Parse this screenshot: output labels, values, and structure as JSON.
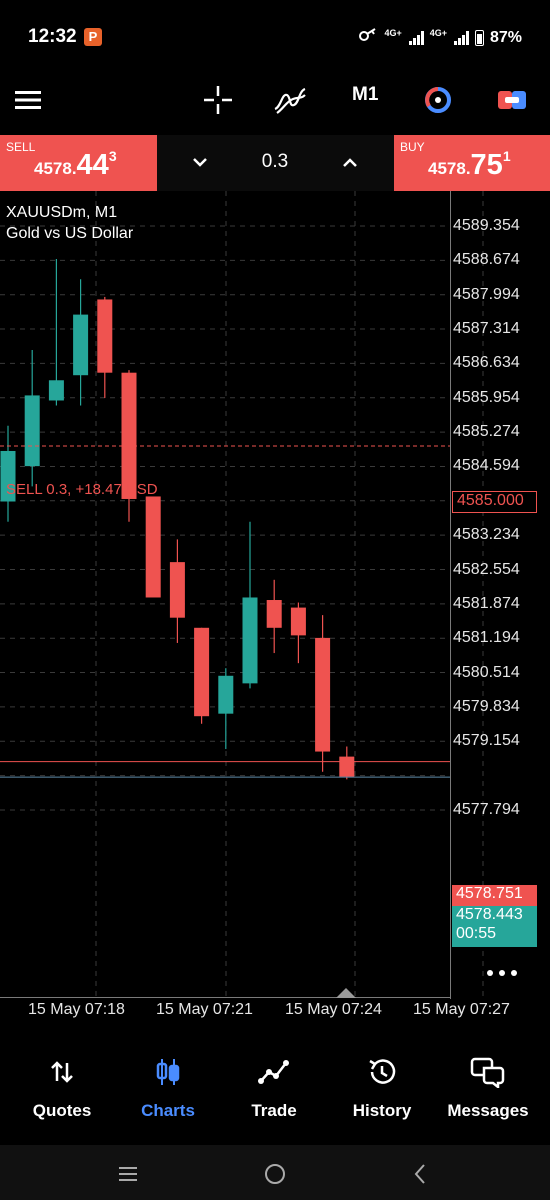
{
  "status": {
    "time": "12:32",
    "app_badge": "P",
    "net1": "4G+",
    "net2": "4G+",
    "battery": "87%"
  },
  "toolbar": {
    "timeframe": "M1"
  },
  "trade": {
    "sell_label": "SELL",
    "sell_small": "4578.",
    "sell_big": "44",
    "sell_sup": "3",
    "buy_label": "BUY",
    "buy_small": "4578.",
    "buy_big": "75",
    "buy_sup": "1",
    "lot": "0.3"
  },
  "chart": {
    "symbol": "XAUUSDm, M1",
    "description": "Gold vs US Dollar",
    "position_label": "SELL 0.3, +18.47 USD",
    "y_labels": [
      "4589.354",
      "4588.674",
      "4587.994",
      "4587.314",
      "4586.634",
      "4585.954",
      "4585.274",
      "4584.594",
      "4583.914",
      "4583.234",
      "4582.554",
      "4581.874",
      "4581.194",
      "4580.514",
      "4579.834",
      "4579.154",
      "4577.794"
    ],
    "x_labels": [
      "15 May 07:18",
      "15 May 07:21",
      "15 May 07:24",
      "15 May 07:27"
    ],
    "order_price_tag": "4585.000",
    "ask_tag": "4578.751",
    "bid_tag": "4578.443",
    "countdown": "00:55",
    "colors": {
      "bull": "#26a69a",
      "bear": "#ef5350",
      "grid": "#3a3a3a",
      "accent": "#4a8cff"
    }
  },
  "chart_data": {
    "type": "candlestick",
    "title": "XAUUSDm, M1",
    "subtitle": "Gold vs US Dollar",
    "ylim": [
      4577.5,
      4590.0
    ],
    "candles": [
      {
        "o": 4583.9,
        "h": 4585.4,
        "l": 4583.5,
        "c": 4584.9
      },
      {
        "o": 4584.6,
        "h": 4586.9,
        "l": 4584.2,
        "c": 4586.0
      },
      {
        "o": 4585.9,
        "h": 4588.7,
        "l": 4585.8,
        "c": 4586.3
      },
      {
        "o": 4586.4,
        "h": 4588.3,
        "l": 4585.8,
        "c": 4587.6
      },
      {
        "o": 4587.9,
        "h": 4587.95,
        "l": 4585.95,
        "c": 4586.45
      },
      {
        "o": 4586.45,
        "h": 4586.5,
        "l": 4583.5,
        "c": 4583.95
      },
      {
        "o": 4584.0,
        "h": 4583.9,
        "l": 4582.25,
        "c": 4582.0
      },
      {
        "o": 4582.7,
        "h": 4583.15,
        "l": 4581.1,
        "c": 4581.6
      },
      {
        "o": 4581.4,
        "h": 4581.4,
        "l": 4579.5,
        "c": 4579.65
      },
      {
        "o": 4579.7,
        "h": 4580.6,
        "l": 4579.0,
        "c": 4580.45
      },
      {
        "o": 4580.3,
        "h": 4583.5,
        "l": 4580.2,
        "c": 4582.0
      },
      {
        "o": 4581.95,
        "h": 4582.35,
        "l": 4580.9,
        "c": 4581.4
      },
      {
        "o": 4581.8,
        "h": 4581.9,
        "l": 4580.7,
        "c": 4581.25
      },
      {
        "o": 4581.2,
        "h": 4581.65,
        "l": 4578.55,
        "c": 4578.95
      },
      {
        "o": 4578.85,
        "h": 4579.05,
        "l": 4578.4,
        "c": 4578.45
      }
    ],
    "x_tick_labels": [
      "15 May 07:18",
      "15 May 07:21",
      "15 May 07:24",
      "15 May 07:27"
    ],
    "y_tick_labels": [
      "4589.354",
      "4588.674",
      "4587.994",
      "4587.314",
      "4586.634",
      "4585.954",
      "4585.274",
      "4584.594",
      "4583.914",
      "4583.234",
      "4582.554",
      "4581.874",
      "4581.194",
      "4580.514",
      "4579.834",
      "4579.154",
      "4577.794"
    ],
    "lines": [
      {
        "label": "4585.000",
        "y": 4585.0
      },
      {
        "label": "4578.751",
        "y": 4578.751
      },
      {
        "label": "4578.443",
        "y": 4578.443
      }
    ],
    "grid": true
  },
  "nav": [
    {
      "label": "Quotes",
      "icon": "quotes-icon"
    },
    {
      "label": "Charts",
      "icon": "charts-icon",
      "active": true
    },
    {
      "label": "Trade",
      "icon": "trade-icon"
    },
    {
      "label": "History",
      "icon": "history-icon"
    },
    {
      "label": "Messages",
      "icon": "messages-icon"
    }
  ]
}
